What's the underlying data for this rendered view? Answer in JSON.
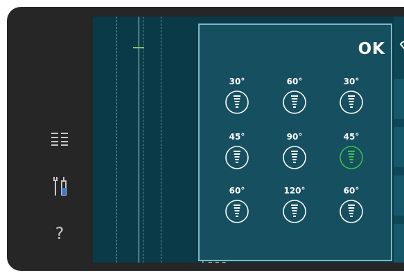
{
  "popup": {
    "ok_label": "OK",
    "angles": [
      [
        "30°",
        "60°",
        "30°"
      ],
      [
        "45°",
        "90°",
        "45°"
      ],
      [
        "60°",
        "120°",
        "60°"
      ]
    ],
    "selected": {
      "row": 1,
      "col": 2
    }
  },
  "sidebar": {
    "icons": [
      "menu-icon",
      "tools-icon",
      "help-icon"
    ],
    "help_label": "?"
  },
  "colors": {
    "screen_bg": "#0a3a47",
    "popup_bg": "#164f60",
    "popup_border": "#7fb7c2",
    "selected": "#39c04a",
    "icon": "#ffffff"
  }
}
